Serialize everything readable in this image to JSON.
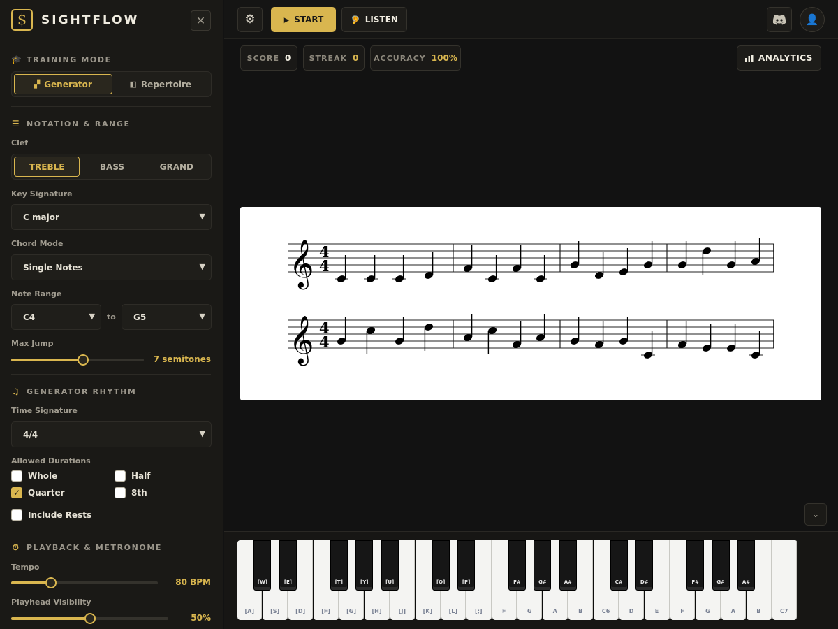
{
  "brand": {
    "name": "SIGHTFLOW",
    "logo_glyph": "$"
  },
  "sidebar": {
    "close_glyph": "✕",
    "training_mode": {
      "title": "TRAINING MODE",
      "options": [
        {
          "label": "Generator",
          "icon": "▞",
          "active": true
        },
        {
          "label": "Repertoire",
          "icon": "◧",
          "active": false
        }
      ]
    },
    "notation": {
      "title": "NOTATION & RANGE",
      "clef_label": "Clef",
      "clef_options": [
        {
          "label": "TREBLE",
          "active": true
        },
        {
          "label": "BASS",
          "active": false
        },
        {
          "label": "GRAND",
          "active": false
        }
      ],
      "key_signature_label": "Key Signature",
      "key_signature_value": "C major",
      "chord_mode_label": "Chord Mode",
      "chord_mode_value": "Single Notes",
      "note_range_label": "Note Range",
      "range_from": "C4",
      "range_to_label": "to",
      "range_to": "G5",
      "max_jump_label": "Max Jump",
      "max_jump_value": "7 semitones",
      "max_jump_fraction": 0.54
    },
    "rhythm": {
      "title": "GENERATOR RHYTHM",
      "time_signature_label": "Time Signature",
      "time_signature_value": "4/4",
      "durations_label": "Allowed Durations",
      "durations": [
        {
          "label": "Whole",
          "checked": false
        },
        {
          "label": "Half",
          "checked": false
        },
        {
          "label": "Quarter",
          "checked": true
        },
        {
          "label": "8th",
          "checked": false
        }
      ],
      "include_rests_label": "Include Rests",
      "include_rests_checked": false
    },
    "playback": {
      "title": "PLAYBACK & METRONOME",
      "tempo_label": "Tempo",
      "tempo_value": "80 BPM",
      "tempo_fraction": 0.27,
      "playhead_label": "Playhead Visibility",
      "playhead_value": "50%",
      "playhead_fraction": 0.5
    }
  },
  "topbar": {
    "start_label": "START",
    "listen_label": "LISTEN"
  },
  "stats": {
    "score_label": "SCORE",
    "score_value": "0",
    "streak_label": "STREAK",
    "streak_value": "0",
    "accuracy_label": "ACCURACY",
    "accuracy_value": "100%"
  },
  "analytics_label": "ANALYTICS",
  "score_sheet": {
    "clef": "treble",
    "time_signature_top": "4",
    "time_signature_bottom": "4",
    "systems": [
      [
        [
          "C4",
          "C4",
          "C4",
          "D4"
        ],
        [
          "F4",
          "C4",
          "F4",
          "C4"
        ],
        [
          "G4",
          "D4",
          "E4",
          "G4"
        ],
        [
          "G4",
          "D5",
          "G4",
          "A4"
        ]
      ],
      [
        [
          "G4",
          "C5",
          "G4",
          "D5"
        ],
        [
          "A4",
          "C5",
          "F4",
          "A4"
        ],
        [
          "G4",
          "F4",
          "G4",
          "C4"
        ],
        [
          "F4",
          "E4",
          "E4",
          "C4"
        ]
      ]
    ]
  },
  "keyboard": {
    "white_keys": [
      "[A]",
      "[S]",
      "[D]",
      "[F]",
      "[G]",
      "[H]",
      "[J]",
      "[K]",
      "[L]",
      "[;]",
      "F",
      "G",
      "A",
      "B",
      "C6",
      "D",
      "E",
      "F",
      "G",
      "A",
      "B",
      "C7"
    ],
    "black_keys": [
      "[W]",
      "[E]",
      "[T]",
      "[Y]",
      "[U]",
      "[O]",
      "[P]",
      "F#",
      "G#",
      "A#",
      "C#",
      "D#",
      "F#",
      "G#",
      "A#"
    ]
  }
}
